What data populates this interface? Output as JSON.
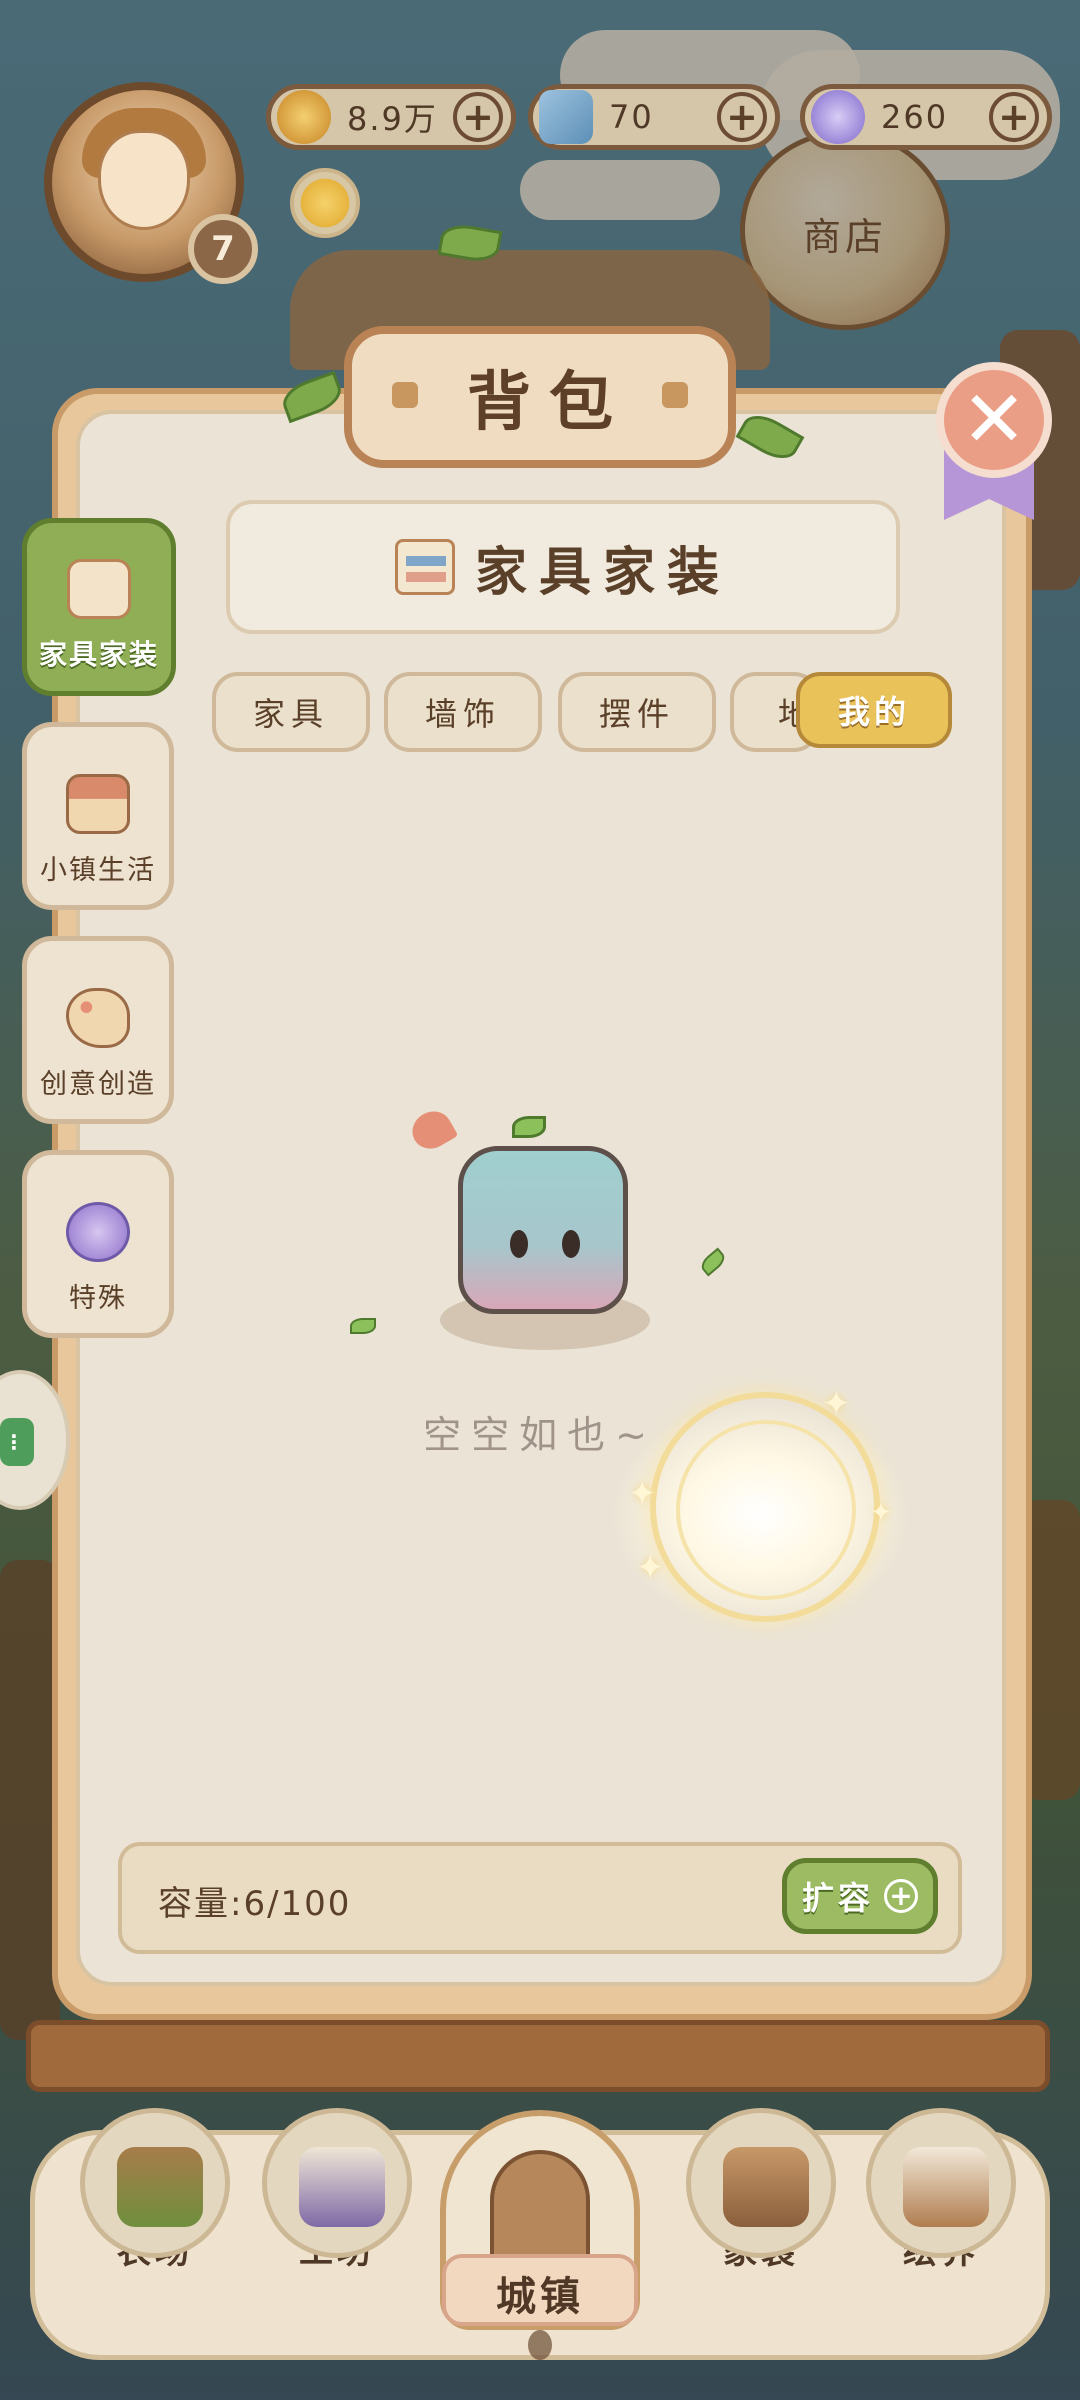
{
  "top_bar": {
    "level": "7",
    "currencies": [
      {
        "icon": "gold-coin-icon",
        "value": "8.9万",
        "color": "#e2b04a"
      },
      {
        "icon": "blue-book-icon",
        "value": "70",
        "color": "#6fa1c7"
      },
      {
        "icon": "star-gem-icon",
        "value": "260",
        "color": "#9a86d8"
      }
    ],
    "plus_symbol": "+",
    "shop_label": "商店"
  },
  "panel": {
    "title": "背包",
    "close_symbol": "✕",
    "category_title": "家具家装",
    "sub_tabs": [
      "家具",
      "墙饰",
      "摆件",
      "地"
    ],
    "active_sub_tab": "我的",
    "side_tabs": [
      {
        "label": "家具家装",
        "icon": "furniture-icon",
        "active": true
      },
      {
        "label": "小镇生活",
        "icon": "house-icon",
        "active": false
      },
      {
        "label": "创意创造",
        "icon": "palette-icon",
        "active": false
      },
      {
        "label": "特殊",
        "icon": "potion-icon",
        "active": false
      }
    ],
    "empty_text": "空空如也~",
    "capacity_text": "容量:6/100",
    "capacity_used": 6,
    "capacity_max": 100,
    "expand_label": "扩容",
    "expand_plus": "+"
  },
  "bottom_nav": {
    "items": [
      {
        "label": "农场",
        "icon": "farm-icon"
      },
      {
        "label": "工坊",
        "icon": "workshop-icon"
      },
      {
        "label": "城镇",
        "icon": "town-icon",
        "active": true
      },
      {
        "label": "家装",
        "icon": "home-decor-icon"
      },
      {
        "label": "绘界",
        "icon": "easel-icon"
      }
    ]
  },
  "colors": {
    "panel_bg": "#ebe4d6",
    "accent_green": "#8fae55",
    "accent_gold": "#e9c35a",
    "close_red": "#eb9e86"
  }
}
